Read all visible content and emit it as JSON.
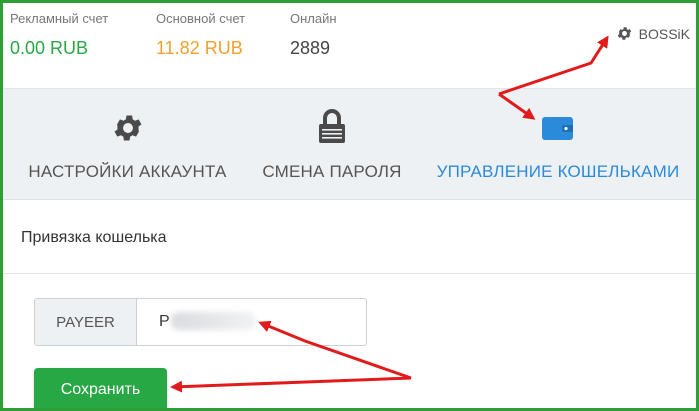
{
  "stats": {
    "ad_account": {
      "label": "Рекламный счет",
      "value": "0.00 RUB"
    },
    "main_account": {
      "label": "Основной счет",
      "value": "11.82 RUB"
    },
    "online": {
      "label": "Онлайн",
      "value": "2889"
    }
  },
  "user": {
    "name": "BOSSiK",
    "icon": "gear-icon"
  },
  "tabs": [
    {
      "label": "НАСТРОЙКИ АККАУНТА",
      "icon": "gear-icon"
    },
    {
      "label": "СМЕНА ПАРОЛЯ",
      "icon": "lock-icon"
    },
    {
      "label": "УПРАВЛЕНИЕ КОШЕЛЬКАМИ",
      "icon": "wallet-icon",
      "active": true
    }
  ],
  "section": {
    "title": "Привязка кошелька"
  },
  "wallet": {
    "addon_label": "PAYEER",
    "value": "P"
  },
  "save_button": {
    "label": "Сохранить"
  },
  "colors": {
    "accent_green": "#28a745",
    "orange": "#f0a02c",
    "link_blue": "#2b8ad9",
    "arrow_red": "#e11b1b"
  }
}
